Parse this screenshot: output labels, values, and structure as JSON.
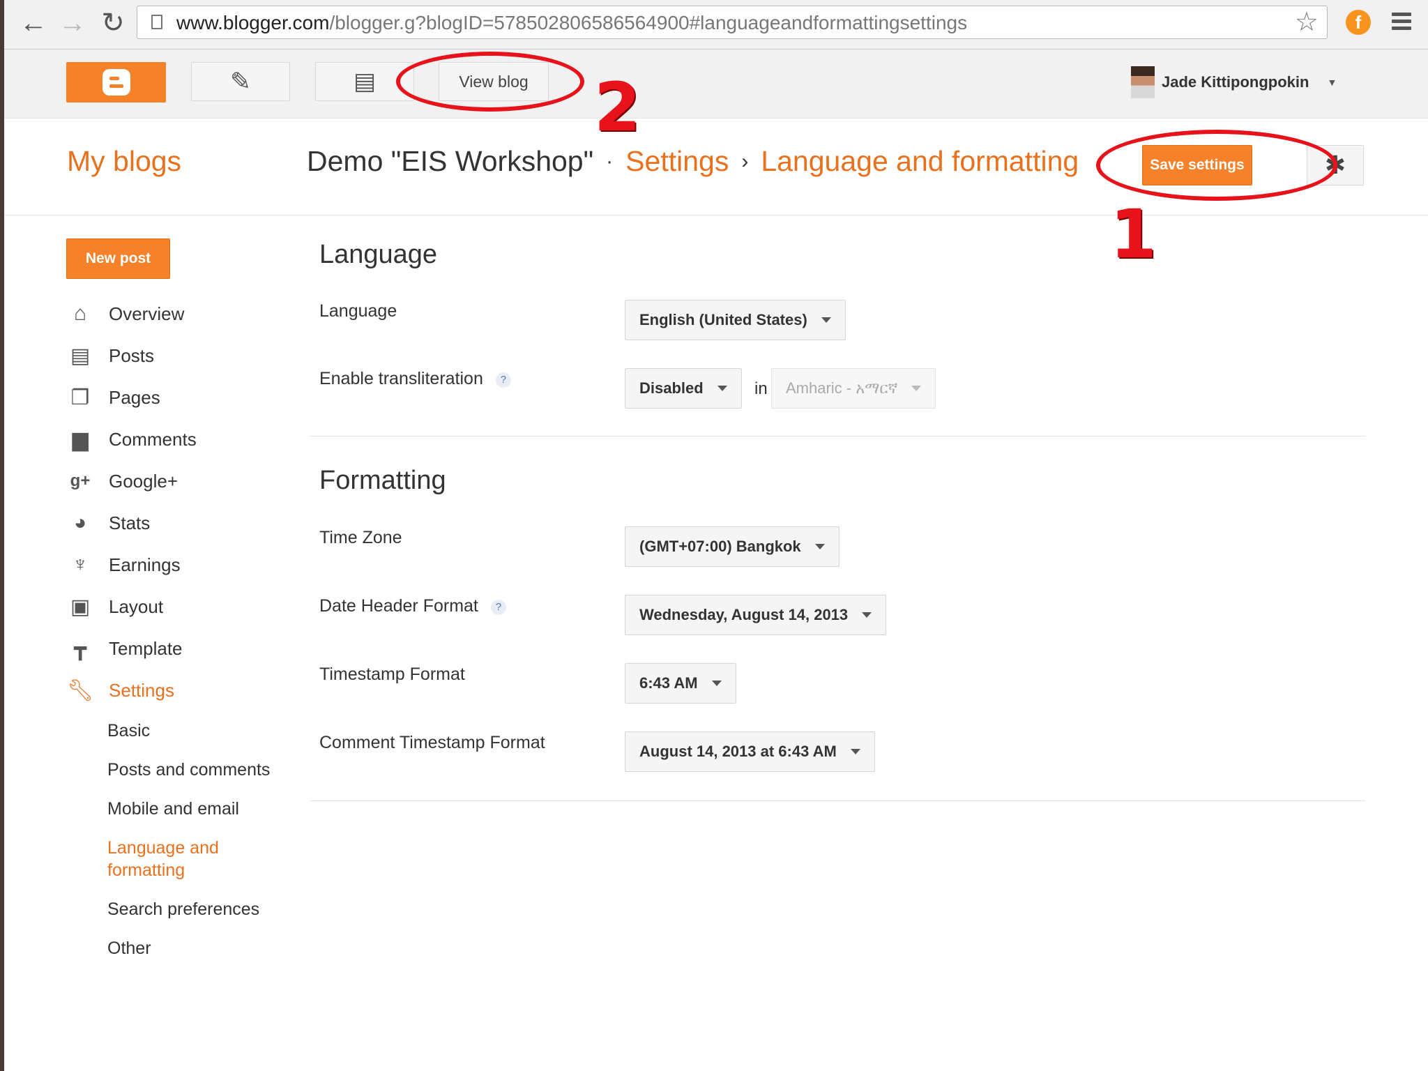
{
  "browser": {
    "url_domain": "www.blogger.com",
    "url_path": "/blogger.g?blogID=5785028065865649​00#languageandformattingsettings",
    "extension_label": "f"
  },
  "topbar": {
    "view_blog_label": "View blog",
    "user_name": "Jade Kittipongpokin"
  },
  "header": {
    "my_blogs": "My blogs",
    "blog_title": "Demo \"EIS Workshop\"",
    "crumb_sep_1": "·",
    "crumb_settings": "Settings",
    "crumb_sep_2": "›",
    "crumb_page": "Language and formatting",
    "save_label": "Save settings"
  },
  "sidebar": {
    "new_post": "New post",
    "items": [
      {
        "label": "Overview",
        "icon": "home-icon"
      },
      {
        "label": "Posts",
        "icon": "posts-icon"
      },
      {
        "label": "Pages",
        "icon": "pages-icon"
      },
      {
        "label": "Comments",
        "icon": "comments-icon"
      },
      {
        "label": "Google+",
        "icon": "google-plus-icon"
      },
      {
        "label": "Stats",
        "icon": "stats-icon"
      },
      {
        "label": "Earnings",
        "icon": "trophy-icon"
      },
      {
        "label": "Layout",
        "icon": "layout-icon"
      },
      {
        "label": "Template",
        "icon": "template-icon"
      },
      {
        "label": "Settings",
        "icon": "wrench-icon"
      }
    ],
    "sub_items": [
      "Basic",
      "Posts and comments",
      "Mobile and email",
      "Language and formatting",
      "Search preferences",
      "Other"
    ]
  },
  "language": {
    "title": "Language",
    "language_label": "Language",
    "language_value": "English (United States)",
    "translit_label": "Enable transliteration",
    "help_mark": "?",
    "translit_value": "Disabled",
    "in_word": "in",
    "translit_lang": "Amharic - አማርኛ"
  },
  "formatting": {
    "title": "Formatting",
    "timezone_label": "Time Zone",
    "timezone_value": "(GMT+07:00) Bangkok",
    "date_header_label": "Date Header Format",
    "date_header_value": "Wednesday, August 14, 2013",
    "timestamp_label": "Timestamp Format",
    "timestamp_value": "6:43 AM",
    "comment_ts_label": "Comment Timestamp Format",
    "comment_ts_value": "August 14, 2013 at 6:43 AM"
  },
  "annotations": {
    "num_1": "1",
    "num_2": "2",
    "color": "#e8121a"
  },
  "colors": {
    "accent": "#f5822a",
    "link": "#e8711e"
  }
}
